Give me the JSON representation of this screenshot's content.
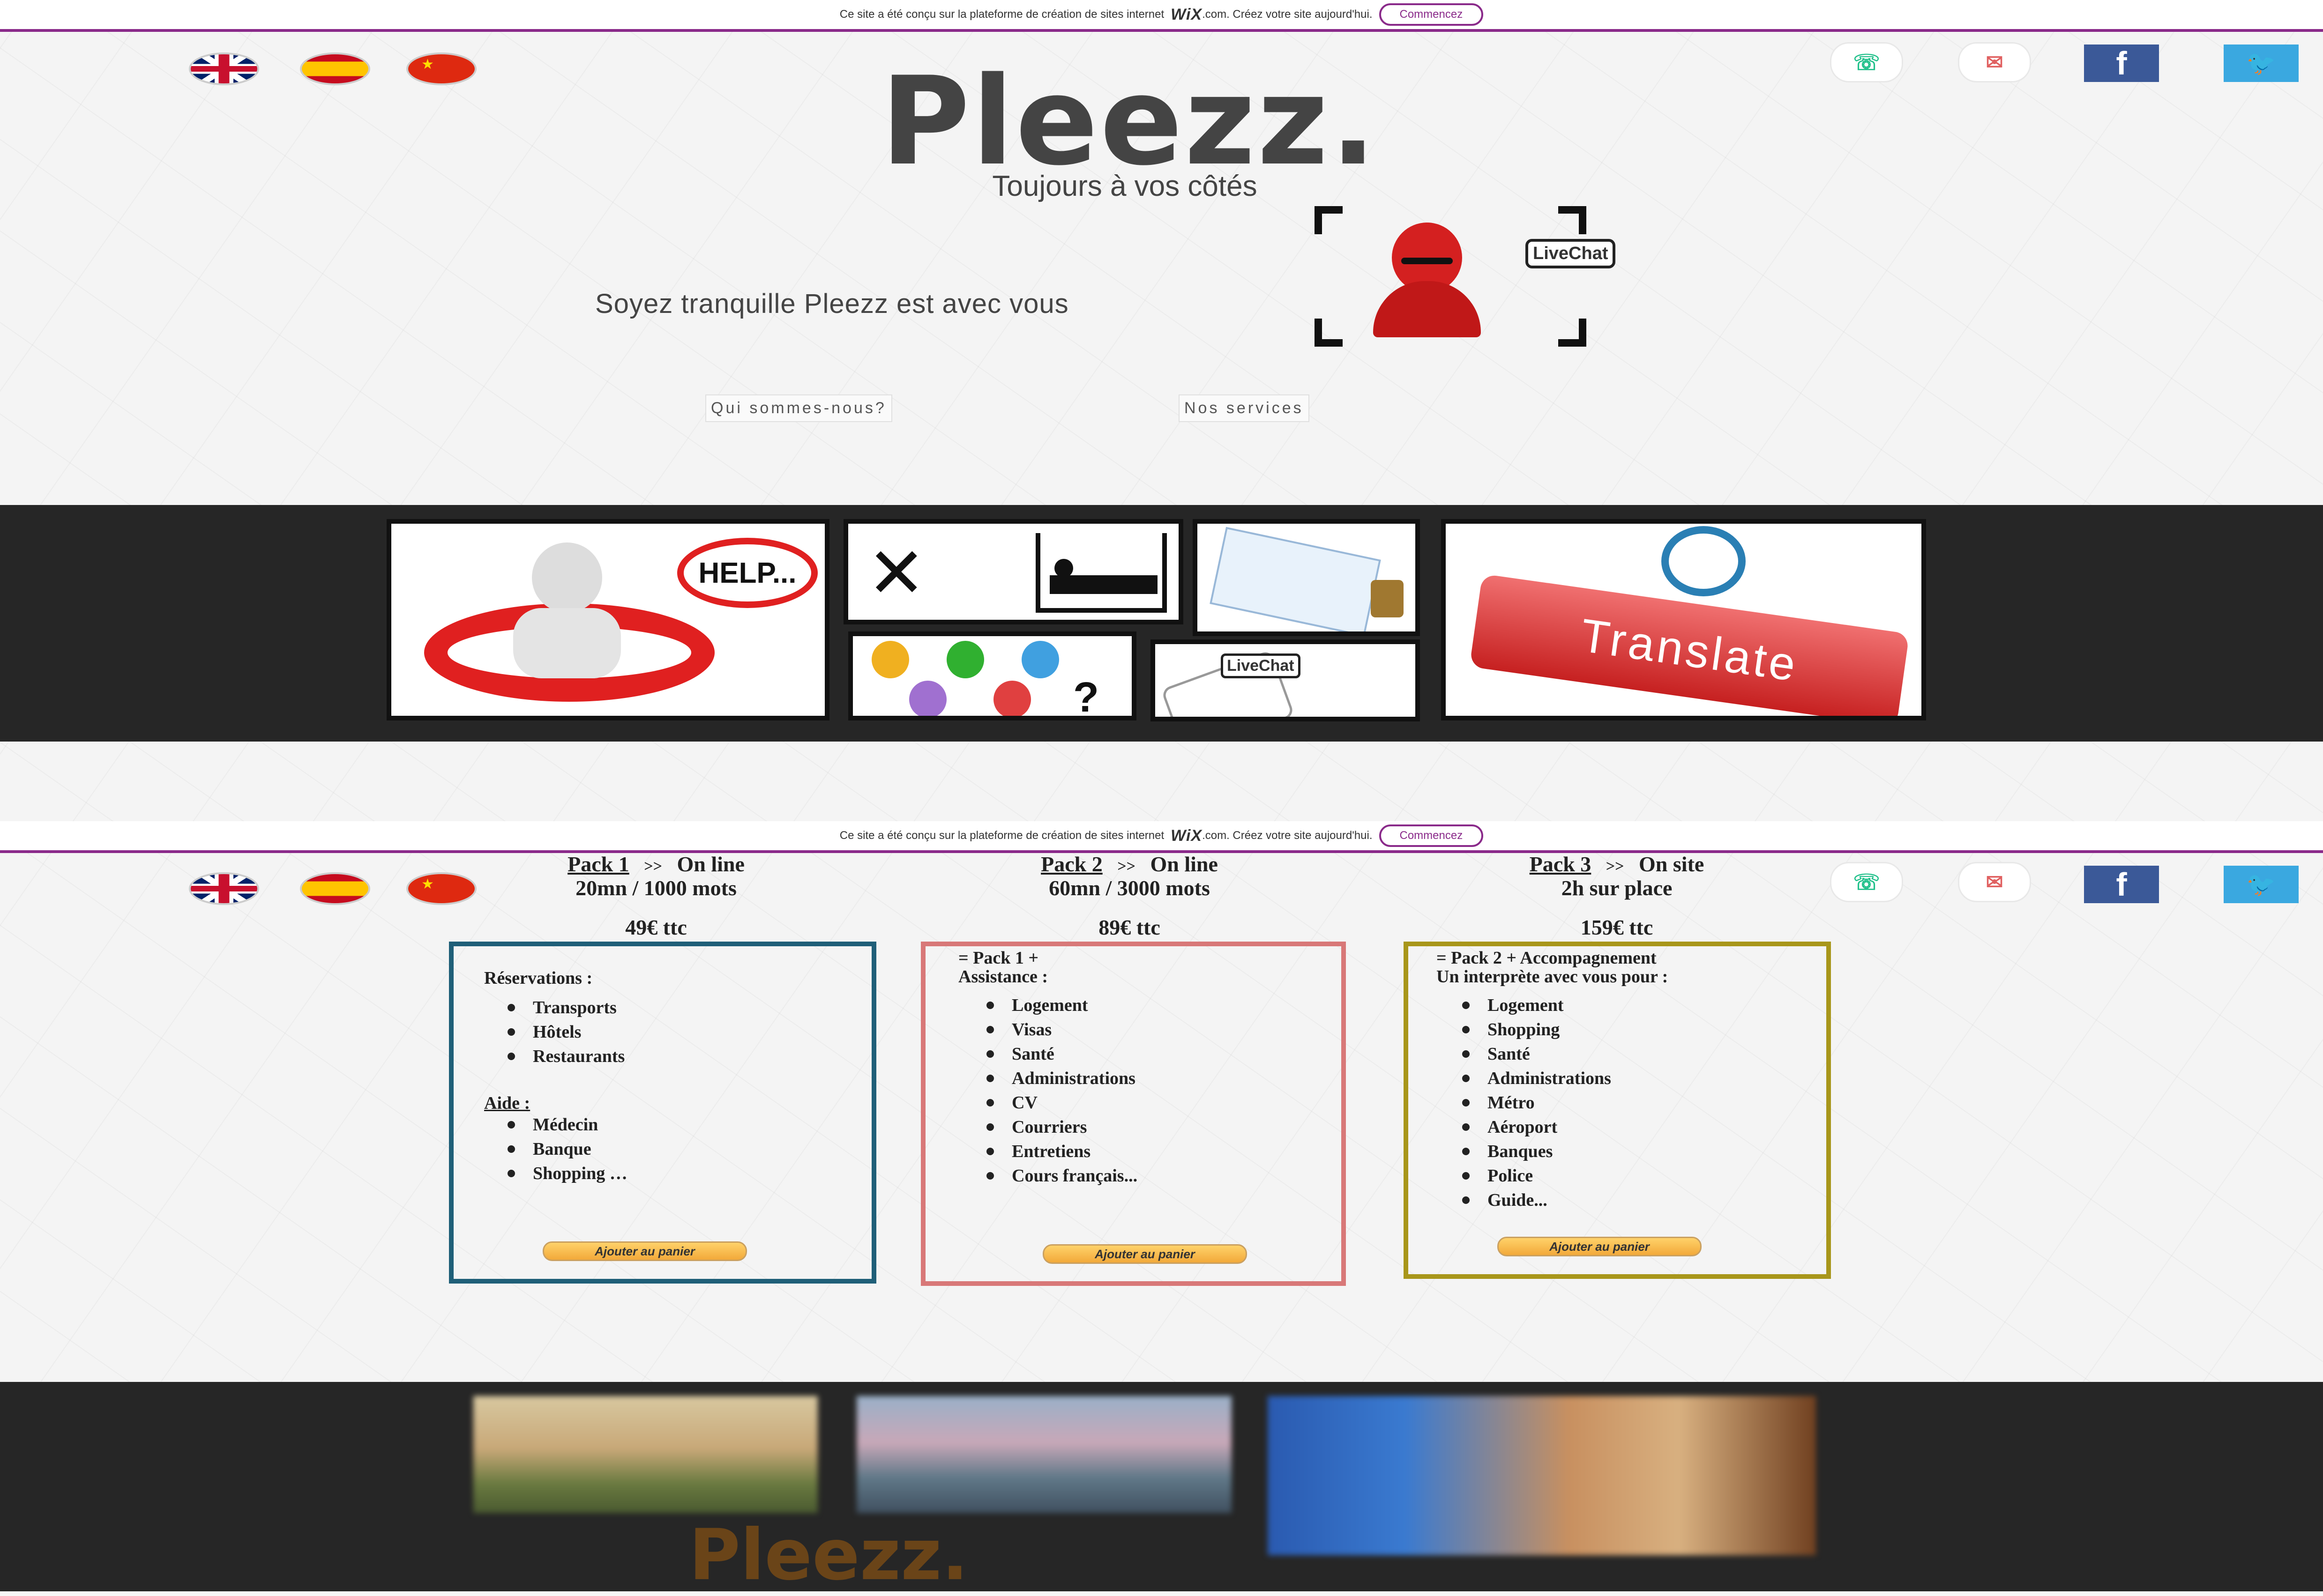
{
  "wix_banner": {
    "text_before": "Ce site a été conçu sur la plateforme de création de sites internet",
    "logo": "WiX",
    "text_after": ".com. Créez votre site aujourd'hui.",
    "button": "Commencez"
  },
  "languages": [
    {
      "name": "english",
      "icon": "uk-flag-icon"
    },
    {
      "name": "spanish",
      "icon": "spain-flag-icon"
    },
    {
      "name": "chinese",
      "icon": "china-flag-icon"
    }
  ],
  "social": {
    "phone_icon": "☏",
    "mail_icon": "✉",
    "facebook_icon": "f",
    "twitter_icon": "🐦"
  },
  "header": {
    "logo": "Pleezz.",
    "tagline": "Toujours à vos côtés",
    "subtitle": "Soyez tranquille Pleezz est avec vous",
    "livechat_label": "LiveChat"
  },
  "nav": {
    "about": "Qui sommes-nous?",
    "services": "Nos services"
  },
  "gallery": {
    "help_sign": "HELP...",
    "livechat_label": "LiveChat",
    "translate_label": "Translate",
    "question_mark": "?"
  },
  "packs": [
    {
      "name": "Pack 1",
      "arrow": ">>",
      "mode": "On line",
      "detail": "20mn / 1000 mots",
      "price": "49€ ttc",
      "border_color": "#1f5f78",
      "section1_title": "Réservations :",
      "section1_items": [
        "Transports",
        "Hôtels",
        "Restaurants"
      ],
      "section2_title": "Aide :",
      "section2_items": [
        "Médecin",
        "Banque",
        "Shopping …"
      ],
      "button": "Ajouter au panier"
    },
    {
      "name": "Pack 2",
      "arrow": ">>",
      "mode": "On line",
      "detail": "60mn / 3000 mots",
      "price": "89€ ttc",
      "border_color": "#d87878",
      "intro_line1": "= Pack 1 +",
      "intro_line2": "Assistance :",
      "items": [
        "Logement",
        "Visas",
        "Santé",
        "Administrations",
        "CV",
        "Courriers",
        "Entretiens",
        "Cours français..."
      ],
      "button": "Ajouter au panier"
    },
    {
      "name": "Pack 3",
      "arrow": ">>",
      "mode": "On site",
      "detail": "2h sur place",
      "price": "159€ ttc",
      "border_color": "#a8961a",
      "intro_line1": "= Pack 2 + Accompagnement",
      "intro_line2": "Un interprète avec vous pour :",
      "items": [
        "Logement",
        "Shopping",
        "Santé",
        "Administrations",
        "Métro",
        "Aéroport",
        "Banques",
        "Police",
        "Guide..."
      ],
      "button": "Ajouter au panier"
    }
  ],
  "footer": {
    "logo": "Pleezz."
  }
}
